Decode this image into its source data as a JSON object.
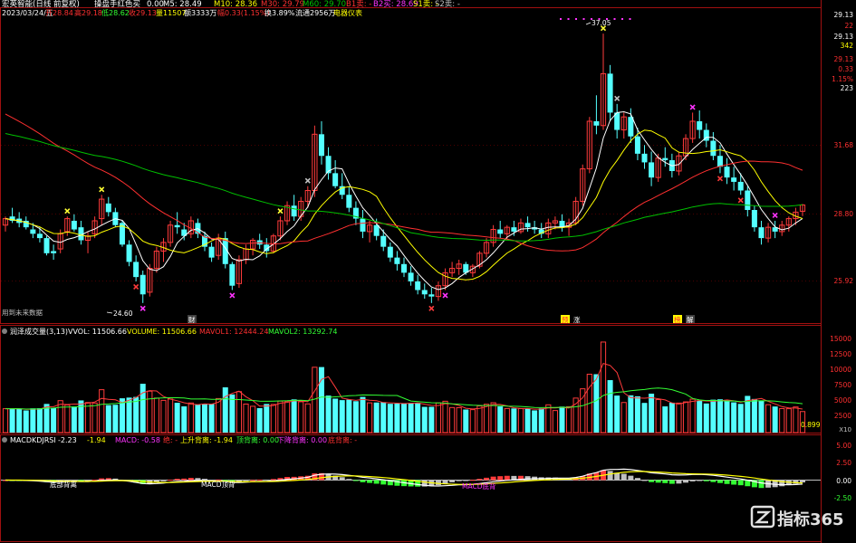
{
  "colors": {
    "background": "#000000",
    "up": "#ff3b3b",
    "down": "#54ffff",
    "ma5": "#ffffff",
    "ma10": "#ffff00",
    "ma30": "#ff3030",
    "ma60": "#00c000",
    "border": "#a01010",
    "magenta": "#ff33ff",
    "yellow": "#ffff33",
    "gray": "#c0c0c0",
    "green": "#33ff33"
  },
  "price_panel": {
    "header": {
      "title": "宏英智能(日线 前复权)",
      "indicator": "操盘手红色买",
      "dividend": "0.00",
      "ma5": "M5: 28.49",
      "ma10": "M10: 28.36",
      "ma30": "M30: 29.79",
      "ma60": "M60: 29.70",
      "b1": "B1卖: -",
      "b2": "B2买: 28.69",
      "s1": "S1卖: -",
      "s2": "S2卖: -",
      "line2_date": "2023/03/24/五",
      "open": "开28.84",
      "high": "高29.18",
      "low": "低28.62",
      "close": "收29.13",
      "volume": "量11507",
      "amount": "额3333万",
      "change": "幅0.33(1.15%)",
      "turnover": "换3.89%",
      "float": "流通2956万",
      "sector": "电器仪表"
    },
    "right_axis": [
      "29.13",
      "22",
      "29.13",
      "342",
      "29.13",
      "0.33",
      "1.15%",
      "223",
      "31.68",
      "28.80",
      "25.92"
    ],
    "peak_label": "37.05",
    "low_label": "24.60",
    "future_label": "用到未来数据",
    "event_labels": [
      "财",
      "预",
      "涨",
      "榜",
      "解"
    ]
  },
  "volume_panel": {
    "header": {
      "name": "润泽成交量(3,13)",
      "vvol": "VVOL: 11506.66",
      "volume": "VOLUME: 11506.66",
      "mavol1": "MAVOL1: 12444.24",
      "mavol2": "MAVOL2: 13292.74"
    },
    "axis": [
      "15000",
      "12500",
      "10000",
      "7500",
      "5000",
      "2500"
    ],
    "last_value": "0.899",
    "unit": "X10"
  },
  "macd_panel": {
    "header": {
      "name": "MACDKDJRSI",
      "v1": "-2.23",
      "v2": "-1.94",
      "macd": "MACD: -0.58",
      "jue": "绝: -",
      "up_div": "上升背离: -1.94",
      "top_warn": "顶背离: 0.00",
      "down_div": "下降背离: 0.00",
      "bottom_div": "底背离: -"
    },
    "axis": [
      "5.00",
      "2.50",
      "0.00",
      "-2.50"
    ],
    "labels": [
      "底部背离",
      "MACD顶背",
      "MACD底背"
    ]
  },
  "watermark": "指标365",
  "chart_data": {
    "type": "candlestick",
    "candles": [
      [
        28.2,
        28.6,
        27.9,
        28.5
      ],
      [
        28.6,
        29.0,
        28.3,
        28.4
      ],
      [
        28.5,
        28.8,
        28.1,
        28.3
      ],
      [
        28.4,
        28.6,
        28.0,
        28.1
      ],
      [
        28.0,
        28.3,
        27.6,
        27.8
      ],
      [
        27.8,
        28.1,
        27.4,
        27.6
      ],
      [
        27.6,
        27.7,
        26.8,
        26.9
      ],
      [
        27.0,
        27.3,
        26.6,
        26.9
      ],
      [
        27.1,
        28.0,
        26.9,
        27.8
      ],
      [
        27.9,
        28.6,
        27.7,
        28.5
      ],
      [
        28.4,
        28.7,
        27.9,
        28.0
      ],
      [
        28.1,
        28.4,
        27.3,
        27.5
      ],
      [
        27.5,
        27.9,
        26.9,
        27.7
      ],
      [
        27.8,
        28.6,
        27.6,
        28.4
      ],
      [
        28.5,
        29.6,
        28.2,
        29.4
      ],
      [
        29.2,
        29.5,
        28.6,
        28.8
      ],
      [
        28.8,
        29.0,
        28.1,
        28.2
      ],
      [
        28.3,
        28.4,
        27.2,
        27.3
      ],
      [
        27.3,
        27.5,
        26.3,
        26.5
      ],
      [
        26.5,
        26.8,
        25.6,
        25.8
      ],
      [
        25.9,
        26.1,
        24.6,
        25.0
      ],
      [
        25.1,
        26.4,
        24.9,
        26.2
      ],
      [
        26.2,
        27.2,
        26.0,
        27.0
      ],
      [
        27.0,
        27.6,
        26.5,
        27.4
      ],
      [
        27.4,
        28.4,
        27.2,
        28.2
      ],
      [
        28.2,
        28.8,
        27.8,
        28.1
      ],
      [
        28.0,
        28.3,
        27.5,
        27.7
      ],
      [
        27.8,
        28.6,
        27.6,
        28.4
      ],
      [
        28.3,
        28.5,
        27.6,
        27.8
      ],
      [
        27.7,
        27.9,
        27.0,
        27.2
      ],
      [
        27.2,
        27.4,
        26.5,
        26.7
      ],
      [
        26.8,
        27.8,
        26.6,
        27.6
      ],
      [
        27.6,
        27.9,
        26.2,
        26.4
      ],
      [
        26.4,
        26.5,
        25.2,
        25.4
      ],
      [
        25.5,
        26.8,
        25.3,
        26.6
      ],
      [
        26.6,
        27.3,
        26.4,
        27.1
      ],
      [
        27.1,
        27.6,
        26.8,
        27.5
      ],
      [
        27.5,
        27.8,
        27.1,
        27.3
      ],
      [
        27.3,
        27.6,
        26.7,
        27.0
      ],
      [
        27.0,
        27.8,
        26.9,
        27.7
      ],
      [
        27.7,
        28.6,
        27.5,
        28.4
      ],
      [
        28.4,
        29.3,
        28.2,
        29.1
      ],
      [
        29.1,
        29.6,
        28.4,
        28.6
      ],
      [
        28.6,
        29.5,
        28.4,
        29.3
      ],
      [
        29.3,
        30.0,
        29.0,
        29.8
      ],
      [
        29.8,
        32.8,
        29.5,
        32.4
      ],
      [
        32.4,
        33.0,
        31.0,
        31.4
      ],
      [
        31.4,
        31.8,
        30.3,
        30.6
      ],
      [
        30.6,
        31.2,
        29.9,
        30.0
      ],
      [
        30.0,
        30.6,
        29.4,
        29.6
      ],
      [
        29.6,
        30.0,
        28.8,
        29.0
      ],
      [
        29.0,
        29.3,
        28.2,
        28.5
      ],
      [
        28.5,
        28.9,
        27.6,
        27.9
      ],
      [
        27.9,
        28.4,
        27.4,
        28.2
      ],
      [
        28.2,
        28.5,
        27.5,
        27.7
      ],
      [
        27.7,
        28.0,
        27.0,
        27.2
      ],
      [
        27.2,
        27.4,
        26.5,
        26.7
      ],
      [
        26.7,
        27.0,
        26.1,
        26.4
      ],
      [
        26.4,
        26.7,
        25.8,
        26.0
      ],
      [
        26.0,
        26.3,
        25.4,
        25.6
      ],
      [
        25.6,
        25.9,
        25.0,
        25.2
      ],
      [
        25.2,
        25.5,
        24.8,
        25.0
      ],
      [
        25.0,
        25.3,
        24.6,
        24.9
      ],
      [
        24.9,
        25.6,
        24.7,
        25.4
      ],
      [
        25.4,
        26.2,
        25.2,
        26.0
      ],
      [
        26.0,
        26.5,
        25.8,
        26.2
      ],
      [
        26.2,
        26.6,
        25.9,
        26.4
      ],
      [
        26.4,
        26.5,
        25.9,
        26.0
      ],
      [
        26.0,
        26.4,
        25.8,
        26.3
      ],
      [
        26.3,
        27.0,
        26.2,
        26.9
      ],
      [
        26.9,
        27.6,
        26.7,
        27.4
      ],
      [
        27.4,
        28.2,
        27.2,
        28.0
      ],
      [
        28.0,
        28.4,
        27.6,
        27.8
      ],
      [
        27.8,
        28.2,
        27.5,
        28.1
      ],
      [
        28.1,
        28.4,
        27.7,
        27.9
      ],
      [
        27.9,
        28.5,
        27.8,
        28.3
      ],
      [
        28.3,
        28.6,
        27.9,
        28.1
      ],
      [
        28.1,
        28.4,
        27.8,
        28.0
      ],
      [
        28.0,
        28.3,
        27.6,
        27.8
      ],
      [
        27.8,
        28.5,
        27.6,
        28.3
      ],
      [
        28.3,
        28.6,
        28.0,
        28.4
      ],
      [
        28.4,
        28.7,
        27.9,
        28.1
      ],
      [
        28.1,
        28.5,
        27.7,
        28.3
      ],
      [
        28.3,
        29.5,
        28.2,
        29.3
      ],
      [
        29.3,
        31.0,
        29.1,
        30.8
      ],
      [
        30.8,
        33.2,
        30.6,
        33.0
      ],
      [
        33.0,
        34.2,
        32.4,
        32.8
      ],
      [
        32.8,
        37.05,
        32.6,
        35.2
      ],
      [
        35.2,
        35.6,
        33.0,
        33.4
      ],
      [
        33.4,
        33.8,
        32.2,
        32.6
      ],
      [
        32.6,
        33.4,
        32.2,
        33.2
      ],
      [
        33.2,
        33.6,
        32.0,
        32.3
      ],
      [
        32.3,
        32.7,
        31.2,
        31.5
      ],
      [
        31.5,
        31.9,
        30.8,
        31.1
      ],
      [
        31.1,
        31.6,
        30.0,
        30.4
      ],
      [
        30.4,
        31.5,
        30.2,
        31.3
      ],
      [
        31.3,
        31.8,
        30.9,
        31.2
      ],
      [
        31.2,
        31.5,
        30.4,
        30.7
      ],
      [
        30.7,
        31.6,
        30.5,
        31.4
      ],
      [
        31.4,
        32.4,
        31.2,
        32.2
      ],
      [
        32.2,
        33.4,
        32.0,
        33.0
      ],
      [
        33.0,
        33.5,
        32.2,
        32.6
      ],
      [
        32.6,
        32.9,
        31.8,
        32.1
      ],
      [
        32.1,
        32.5,
        31.2,
        31.4
      ],
      [
        31.4,
        31.9,
        30.6,
        30.9
      ],
      [
        30.9,
        31.3,
        30.1,
        30.4
      ],
      [
        30.4,
        30.9,
        29.8,
        30.2
      ],
      [
        30.2,
        30.6,
        29.6,
        29.8
      ],
      [
        29.8,
        30.0,
        28.6,
        28.9
      ],
      [
        28.9,
        29.1,
        27.9,
        28.1
      ],
      [
        28.1,
        28.4,
        27.3,
        27.6
      ],
      [
        27.6,
        28.3,
        27.4,
        28.1
      ],
      [
        28.1,
        28.4,
        27.6,
        27.9
      ],
      [
        27.9,
        28.4,
        27.7,
        28.2
      ],
      [
        28.2,
        28.6,
        27.9,
        28.5
      ],
      [
        28.5,
        29.0,
        28.2,
        28.8
      ],
      [
        28.84,
        29.18,
        28.62,
        29.13
      ]
    ]
  }
}
